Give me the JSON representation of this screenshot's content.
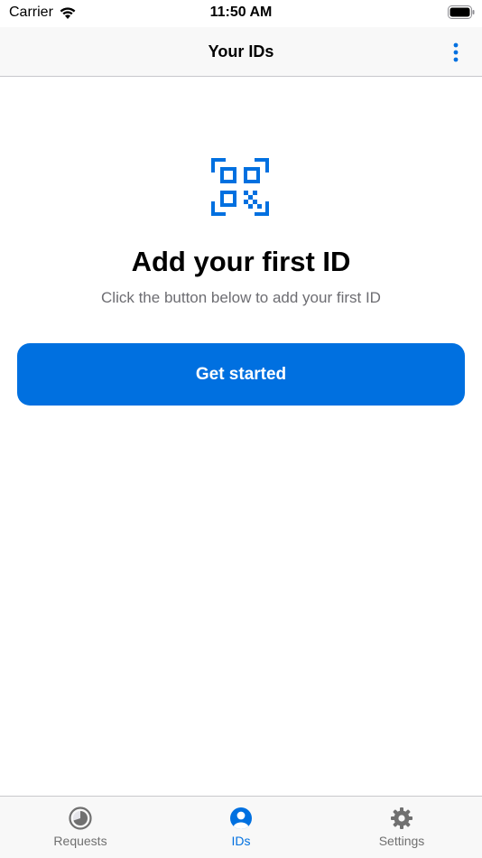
{
  "status_bar": {
    "carrier": "Carrier",
    "time": "11:50 AM",
    "wifi_icon": "wifi-icon",
    "battery_icon": "battery-icon"
  },
  "nav": {
    "title": "Your IDs",
    "more_icon": "more-vertical-icon"
  },
  "empty_state": {
    "icon": "qr-code-icon",
    "title": "Add your first ID",
    "subtitle": "Click the button below to add your first ID",
    "button_label": "Get started"
  },
  "tabs": [
    {
      "label": "Requests",
      "icon": "clock-icon",
      "active": false
    },
    {
      "label": "IDs",
      "icon": "person-circle-icon",
      "active": true
    },
    {
      "label": "Settings",
      "icon": "gear-icon",
      "active": false
    }
  ],
  "colors": {
    "accent": "#0070E0",
    "inactive_tab": "#707070",
    "subtitle_text": "#6D6D72",
    "bar_background": "#F8F8F8"
  }
}
